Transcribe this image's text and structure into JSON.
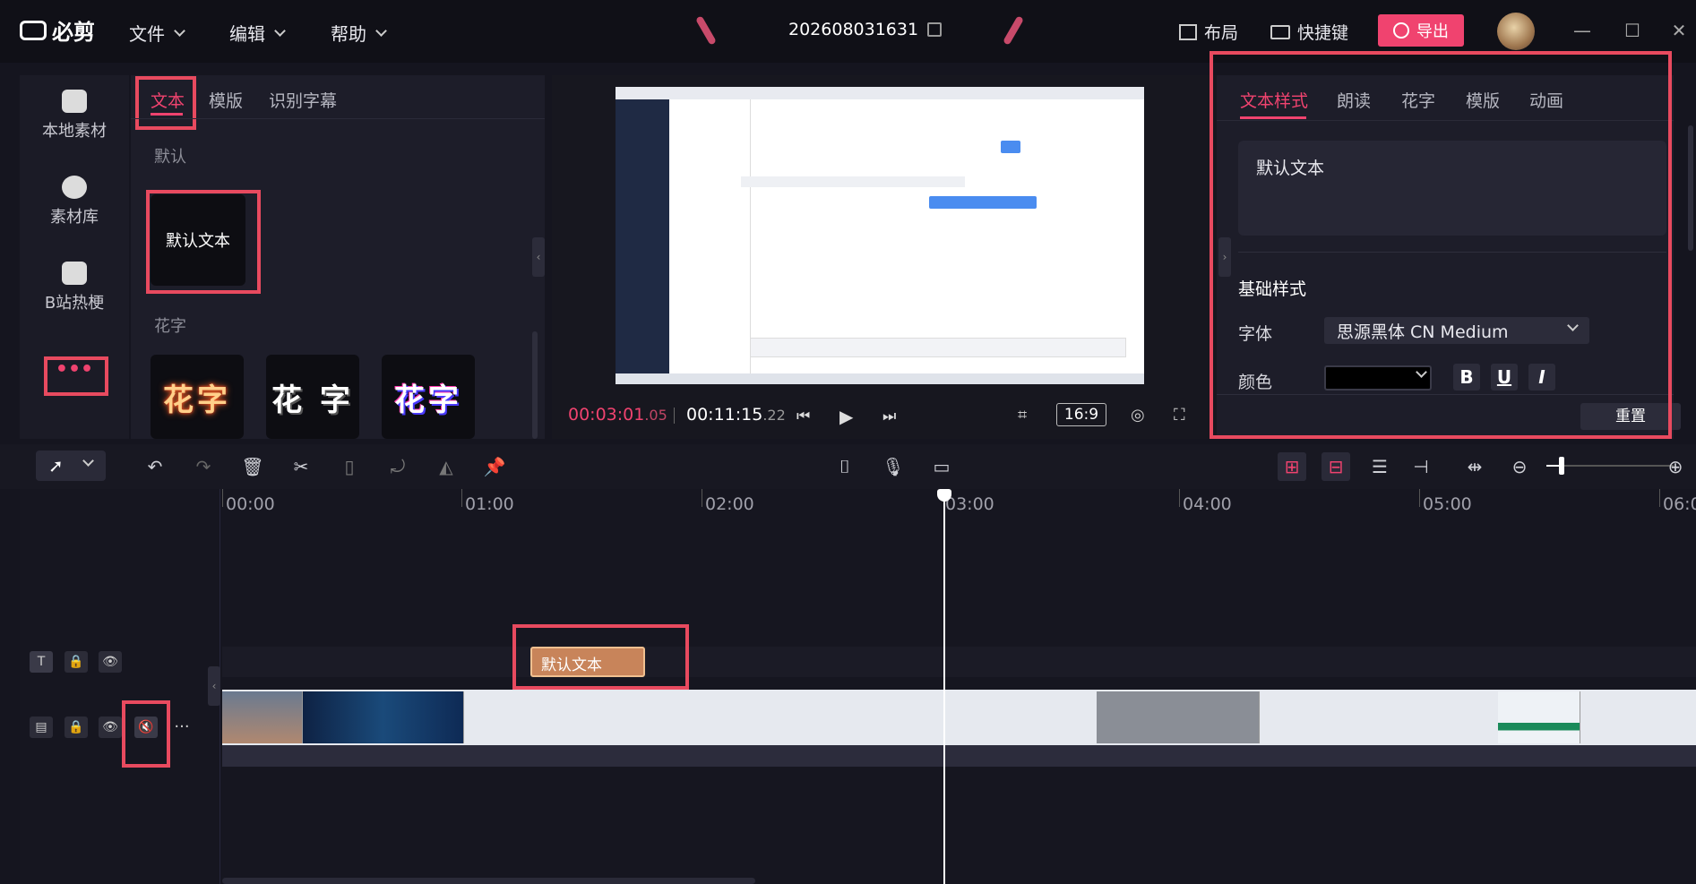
{
  "app": {
    "name": "必剪"
  },
  "menus": [
    {
      "label": "文件"
    },
    {
      "label": "编辑"
    },
    {
      "label": "帮助"
    }
  ],
  "project": {
    "title": "202608031631"
  },
  "topbar_right": {
    "layout_label": "布局",
    "shortcut_label": "快捷键",
    "export_label": "导出"
  },
  "left_sidebar": {
    "items": [
      {
        "label": "本地素材",
        "icon": "upload-folder-icon"
      },
      {
        "label": "素材库",
        "icon": "library-icon"
      },
      {
        "label": "B站热梗",
        "icon": "bilibili-tv-icon"
      },
      {
        "label": "•••",
        "icon": "more-icon"
      }
    ]
  },
  "material_panel": {
    "tabs": [
      {
        "label": "文本"
      },
      {
        "label": "模版"
      },
      {
        "label": "识别字幕"
      }
    ],
    "active_tab": "文本",
    "section_default": "默认",
    "default_card_text": "默认文本",
    "section_huazi": "花字",
    "huazi_cards": [
      {
        "text": "花字"
      },
      {
        "text": "花 字"
      },
      {
        "text": "花字"
      }
    ]
  },
  "preview": {
    "current_time": "00:03:01",
    "current_frame": ".05",
    "total_time": "00:11:15",
    "total_frame": ".22",
    "aspect_ratio": "16:9"
  },
  "property_panel": {
    "tabs": [
      {
        "label": "文本样式"
      },
      {
        "label": "朗读"
      },
      {
        "label": "花字"
      },
      {
        "label": "模版"
      },
      {
        "label": "动画"
      }
    ],
    "active_tab": "文本样式",
    "text_value": "默认文本",
    "section_basic": "基础样式",
    "font_label": "字体",
    "font_value": "思源黑体 CN Medium",
    "color_label": "颜色",
    "color_value": "#000000",
    "bold": "B",
    "underline": "U",
    "italic": "I",
    "reset_label": "重置"
  },
  "timeline": {
    "ruler": [
      "00:00",
      "01:00",
      "02:00",
      "03:00",
      "04:00",
      "05:00",
      "06:0"
    ],
    "text_clip_label": "默认文本",
    "playhead_time": "03:00"
  },
  "colors": {
    "accent": "#f0436f",
    "highlight_box": "#e84a5f",
    "clip": "#c8845a"
  }
}
